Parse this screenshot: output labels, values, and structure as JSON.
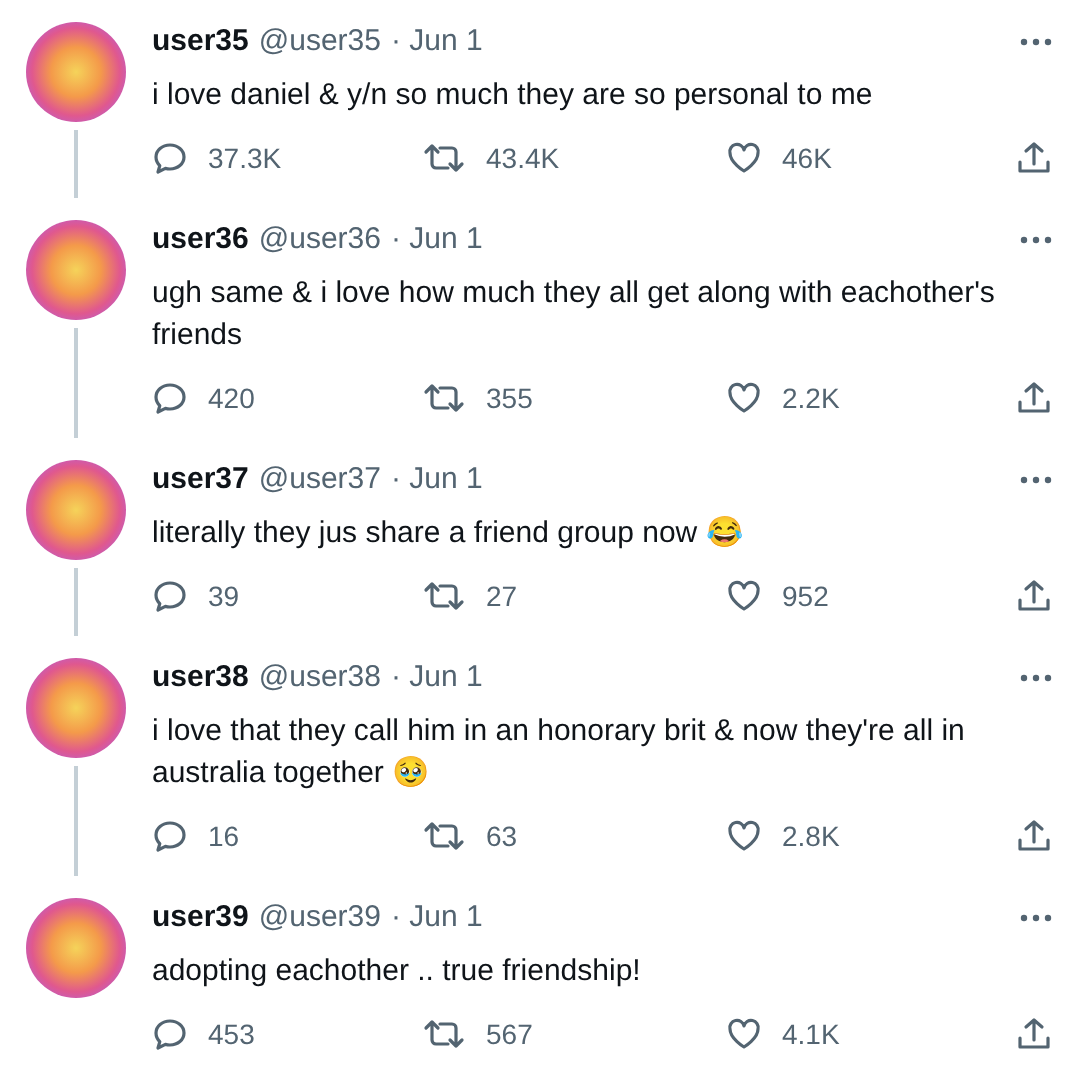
{
  "tweets": [
    {
      "name": "user35",
      "handle": "@user35",
      "date": "· Jun 1",
      "text": "i love daniel & y/n so much they are so personal to me",
      "replies": "37.3K",
      "retweets": "43.4K",
      "likes": "46K",
      "thread_line": true
    },
    {
      "name": "user36",
      "handle": "@user36",
      "date": "· Jun 1",
      "text": "ugh same & i love how much they all get along with eachother's friends",
      "replies": "420",
      "retweets": "355",
      "likes": "2.2K",
      "thread_line": true
    },
    {
      "name": "user37",
      "handle": "@user37",
      "date": "· Jun 1",
      "text": "literally they jus share a friend group now 😂",
      "replies": "39",
      "retweets": "27",
      "likes": "952",
      "thread_line": true
    },
    {
      "name": "user38",
      "handle": "@user38",
      "date": "· Jun 1",
      "text": "i love that they call him in an honorary brit & now they're all in australia together 🥹",
      "replies": "16",
      "retweets": "63",
      "likes": "2.8K",
      "thread_line": true
    },
    {
      "name": "user39",
      "handle": "@user39",
      "date": "· Jun 1",
      "text": "adopting eachother .. true friendship!",
      "replies": "453",
      "retweets": "567",
      "likes": "4.1K",
      "thread_line": false
    }
  ]
}
